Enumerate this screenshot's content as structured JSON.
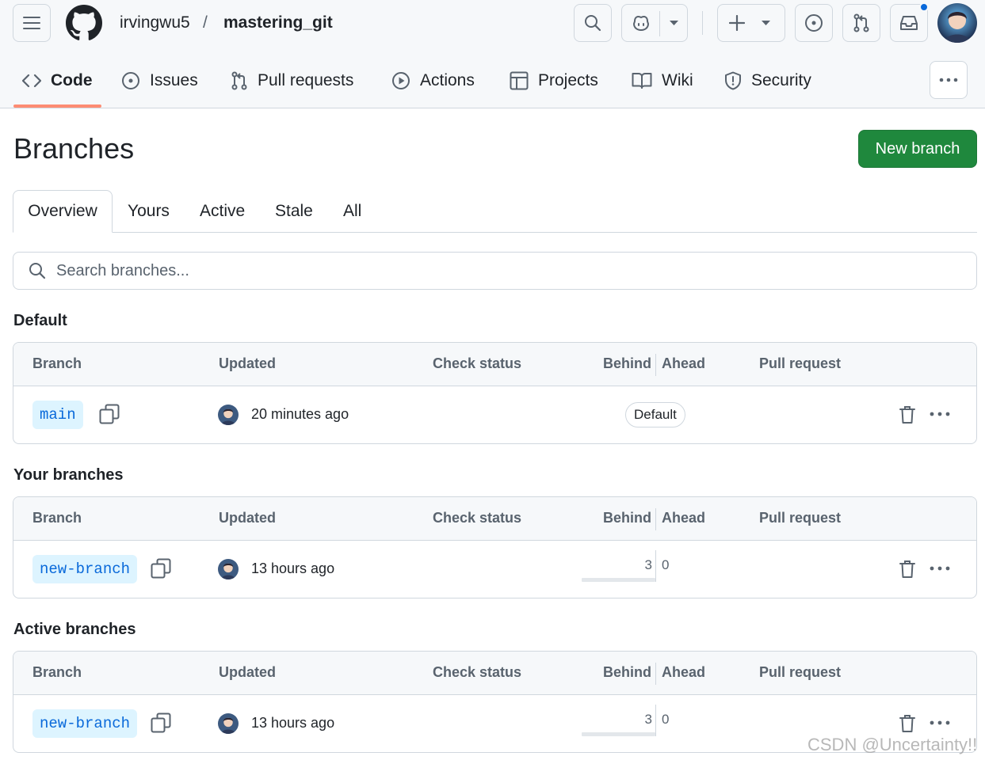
{
  "header": {
    "owner": "irvingwu5",
    "separator": "/",
    "repo": "mastering_git"
  },
  "repo_nav": {
    "items": [
      {
        "label": "Code",
        "icon": "code-icon",
        "selected": true
      },
      {
        "label": "Issues",
        "icon": "issue-opened-icon"
      },
      {
        "label": "Pull requests",
        "icon": "git-pull-request-icon"
      },
      {
        "label": "Actions",
        "icon": "play-icon"
      },
      {
        "label": "Projects",
        "icon": "table-icon"
      },
      {
        "label": "Wiki",
        "icon": "book-icon"
      },
      {
        "label": "Security",
        "icon": "shield-icon"
      }
    ]
  },
  "page": {
    "title": "Branches",
    "new_branch_label": "New branch"
  },
  "tabs": [
    {
      "label": "Overview",
      "active": true
    },
    {
      "label": "Yours"
    },
    {
      "label": "Active"
    },
    {
      "label": "Stale"
    },
    {
      "label": "All"
    }
  ],
  "search": {
    "placeholder": "Search branches..."
  },
  "columns": [
    "Branch",
    "Updated",
    "Check status",
    "Behind",
    "Ahead",
    "Pull request"
  ],
  "sections": [
    {
      "title": "Default",
      "rows": [
        {
          "branch": "main",
          "updated": "20 minutes ago",
          "badge": "Default"
        }
      ]
    },
    {
      "title": "Your branches",
      "rows": [
        {
          "branch": "new-branch",
          "updated": "13 hours ago",
          "behind": "3",
          "ahead": "0"
        }
      ]
    },
    {
      "title": "Active branches",
      "rows": [
        {
          "branch": "new-branch",
          "updated": "13 hours ago",
          "behind": "3",
          "ahead": "0"
        }
      ]
    }
  ],
  "watermark": "CSDN @Uncertainty!!",
  "colors": {
    "primary_green": "#1f883d",
    "branch_chip_bg": "#ddf4ff",
    "branch_chip_text": "#0969da",
    "nav_underline": "#fd8c73",
    "notification_dot": "#0969da"
  }
}
